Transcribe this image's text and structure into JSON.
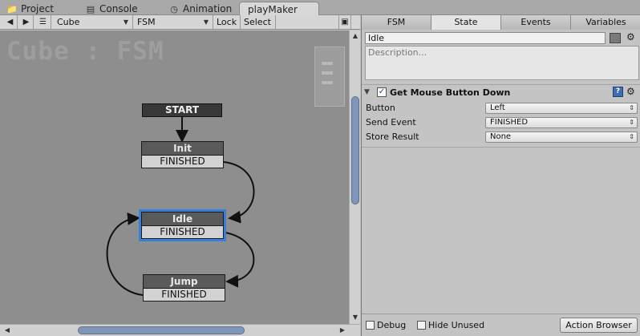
{
  "tabs": [
    {
      "label": "Project",
      "icon": "folder-icon",
      "active": false
    },
    {
      "label": "Console",
      "icon": "console-icon",
      "active": false
    },
    {
      "label": "Animation",
      "icon": "animation-icon",
      "active": false
    },
    {
      "label": "playMaker",
      "icon": "",
      "active": true
    }
  ],
  "toolbar": {
    "gameobject": "Cube",
    "fsm": "FSM",
    "lock": "Lock",
    "select": "Select"
  },
  "canvas": {
    "title": "Cube : FSM",
    "start_label": "START",
    "states": [
      {
        "name": "Init",
        "event": "FINISHED",
        "selected": false
      },
      {
        "name": "Idle",
        "event": "FINISHED",
        "selected": true
      },
      {
        "name": "Jump",
        "event": "FINISHED",
        "selected": false
      }
    ]
  },
  "panel": {
    "tabs": [
      "FSM",
      "State",
      "Events",
      "Variables"
    ],
    "active_tab": "State",
    "state_name": "Idle",
    "description_placeholder": "Description...",
    "action": {
      "title": "Get Mouse Button Down",
      "enabled": true,
      "properties": [
        {
          "label": "Button",
          "value": "Left"
        },
        {
          "label": "Send Event",
          "value": "FINISHED"
        },
        {
          "label": "Store Result",
          "value": "None"
        }
      ]
    },
    "footer": {
      "debug_label": "Debug",
      "hide_unused_label": "Hide Unused",
      "action_browser_label": "Action Browser"
    }
  },
  "colors": {
    "canvas_bg": "#8e8e8e",
    "selection": "#3a7ed8",
    "state_header": "#5a5a5a",
    "scroll_thumb": "#7e97b8"
  }
}
